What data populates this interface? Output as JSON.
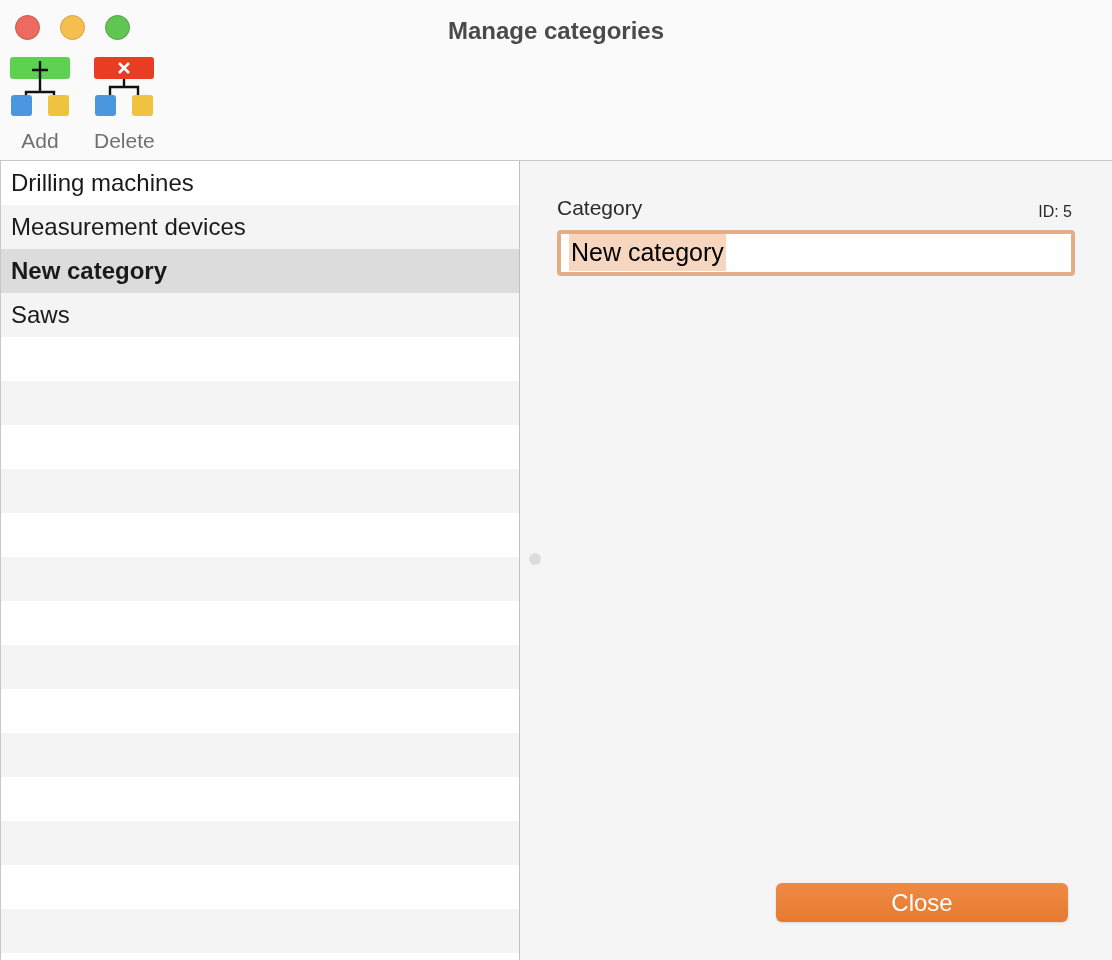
{
  "window": {
    "title": "Manage categories"
  },
  "toolbar": [
    {
      "kind": "add",
      "label": "Add"
    },
    {
      "kind": "delete",
      "label": "Delete"
    }
  ],
  "categories": [
    {
      "name": "Drilling machines",
      "selected": false
    },
    {
      "name": "Measurement devices",
      "selected": false
    },
    {
      "name": "New category",
      "selected": true
    },
    {
      "name": "Saws",
      "selected": false
    }
  ],
  "detail": {
    "label": "Category",
    "id": "ID: 5",
    "value": "New category",
    "text_selected": true,
    "focused": true
  },
  "buttons": [
    {
      "label": "Close"
    }
  ]
}
